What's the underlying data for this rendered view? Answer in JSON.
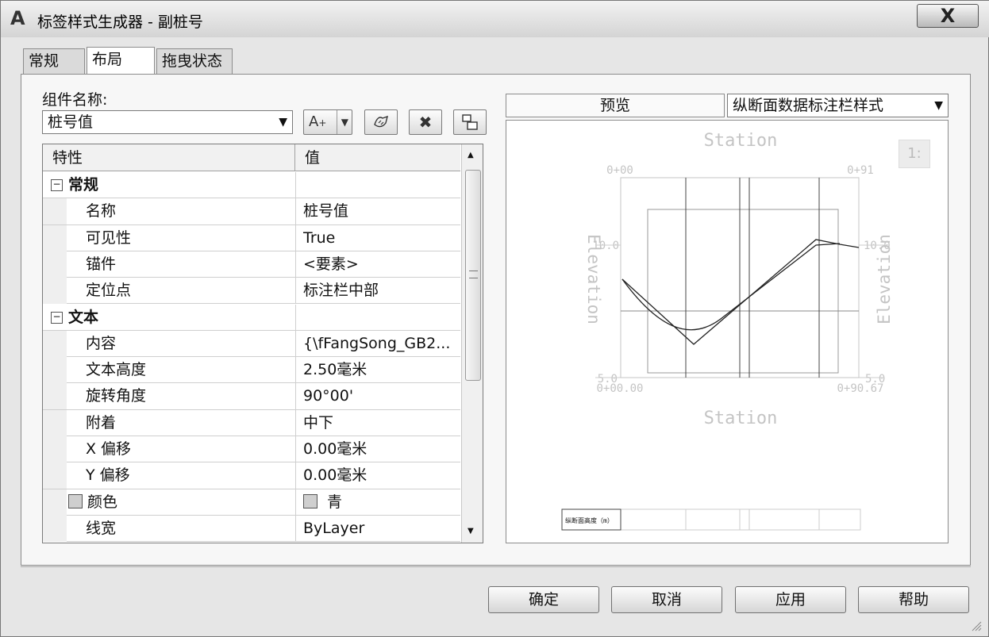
{
  "window": {
    "title": "标签样式生成器 - 副桩号",
    "app_icon_letter": "A",
    "close_label": "X"
  },
  "tabs": [
    {
      "label": "常规",
      "active": false
    },
    {
      "label": "布局",
      "active": true
    },
    {
      "label": "拖曳状态",
      "active": false
    }
  ],
  "component": {
    "label": "组件名称:",
    "selected": "桩号值"
  },
  "toolbar": {
    "add_text_icon": "A",
    "add_text_sub": "+"
  },
  "grid": {
    "header_property": "特性",
    "header_value": "值",
    "rows": [
      {
        "kind": "category",
        "property": "常规",
        "value": ""
      },
      {
        "kind": "prop",
        "property": "名称",
        "value": "桩号值"
      },
      {
        "kind": "prop",
        "property": "可见性",
        "value": "True"
      },
      {
        "kind": "prop",
        "property": "锚件",
        "value": "<要素>"
      },
      {
        "kind": "prop",
        "property": "定位点",
        "value": "标注栏中部"
      },
      {
        "kind": "category",
        "property": "文本",
        "value": ""
      },
      {
        "kind": "prop",
        "property": "内容",
        "value": "{\\fFangSong_GB2..."
      },
      {
        "kind": "prop",
        "property": "文本高度",
        "value": "2.50毫米"
      },
      {
        "kind": "prop",
        "property": "旋转角度",
        "value": "90°00'"
      },
      {
        "kind": "prop",
        "property": "附着",
        "value": "中下"
      },
      {
        "kind": "prop",
        "property": "X 偏移",
        "value": "0.00毫米"
      },
      {
        "kind": "prop",
        "property": "Y 偏移",
        "value": "0.00毫米"
      },
      {
        "kind": "swatch",
        "property": "颜色",
        "value": "青"
      },
      {
        "kind": "prop",
        "property": "线宽",
        "value": "ByLayer"
      }
    ]
  },
  "preview": {
    "label": "预览",
    "style_selected": "纵断面数据标注栏样式",
    "title_top": "Station",
    "title_bottom": "Station",
    "axis_left": "Elevation",
    "axis_right": "Elevation",
    "tick_top_left": "0+00",
    "tick_top_right": "0+91",
    "tick_bottom_left": "0+00.00",
    "tick_bottom_right": "0+90.67",
    "elev_left_top": "10.0",
    "elev_right_top": "10.0",
    "elev_left_bottom": "5.0",
    "elev_right_bottom": "5.0",
    "band_label": "纵断面高度（m）",
    "zoom_button": "1:"
  },
  "buttons": {
    "ok": "确定",
    "cancel": "取消",
    "apply": "应用",
    "help": "帮助"
  }
}
